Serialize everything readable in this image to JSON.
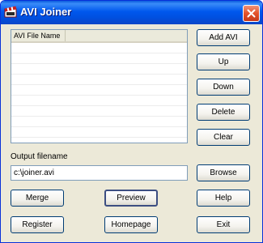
{
  "window": {
    "title": "AVI Joiner",
    "icons": {
      "app": "avi-joiner-app-icon",
      "close": "close-icon"
    }
  },
  "file_list": {
    "column_header": "AVI File Name",
    "rows": []
  },
  "side_buttons": {
    "add": "Add AVI",
    "up": "Up",
    "down": "Down",
    "delete": "Delete",
    "clear": "Clear"
  },
  "output": {
    "label": "Output filename",
    "value": "c:\\joiner.avi",
    "browse": "Browse"
  },
  "bottom_buttons": {
    "merge": "Merge",
    "preview": "Preview",
    "help": "Help",
    "register": "Register",
    "homepage": "Homepage",
    "exit": "Exit"
  },
  "colors": {
    "titlebar": "#0058ee",
    "window_bg": "#ece9d8",
    "close_button": "#e3532b"
  }
}
